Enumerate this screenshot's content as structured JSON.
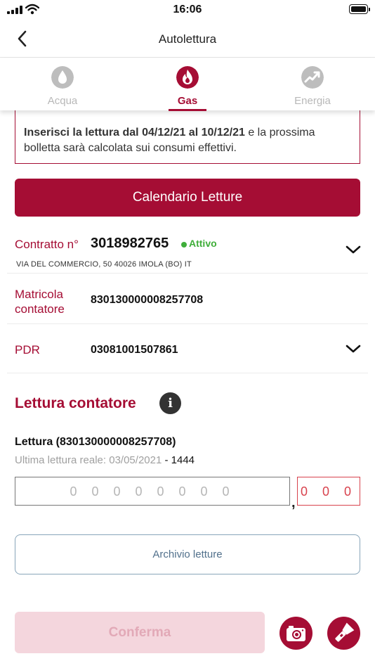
{
  "status_bar": {
    "time": "16:06"
  },
  "header": {
    "title": "Autolettura"
  },
  "tabs": [
    {
      "label": "Acqua",
      "icon": "water-drop-icon",
      "active": false
    },
    {
      "label": "Gas",
      "icon": "flame-icon",
      "active": true
    },
    {
      "label": "Energia",
      "icon": "energy-chart-icon",
      "active": false
    }
  ],
  "notice": {
    "bold": "Inserisci la lettura dal 04/12/21 al 10/12/21",
    "rest": " e la prossima bolletta sarà calcolata sui consumi effettivi."
  },
  "calendar_button": "Calendario Letture",
  "contract": {
    "label": "Contratto n°",
    "number": "3018982765",
    "status": "Attivo",
    "address": "VIA DEL COMMERCIO, 50 40026 IMOLA (BO) IT"
  },
  "meter": {
    "label_line1": "Matricola",
    "label_line2": "contatore",
    "value": "830130000008257708"
  },
  "pdr": {
    "label": "PDR",
    "value": "03081001507861"
  },
  "reading_section": {
    "title": "Lettura contatore",
    "reading_label": "Lettura (830130000008257708)",
    "last_label": "Ultima lettura reale:",
    "last_date": "03/05/2021",
    "last_value": " - 1444",
    "input_placeholder": "0 0 0 0 0 0 0 0",
    "comma": ",",
    "decimal_placeholder": "0 0 0"
  },
  "archive_button": "Archivio letture",
  "confirm_button": "Conferma",
  "colors": {
    "brand": "#a50d34",
    "active_status": "#3fae3a",
    "confirm_disabled": "#f4d6dd"
  }
}
